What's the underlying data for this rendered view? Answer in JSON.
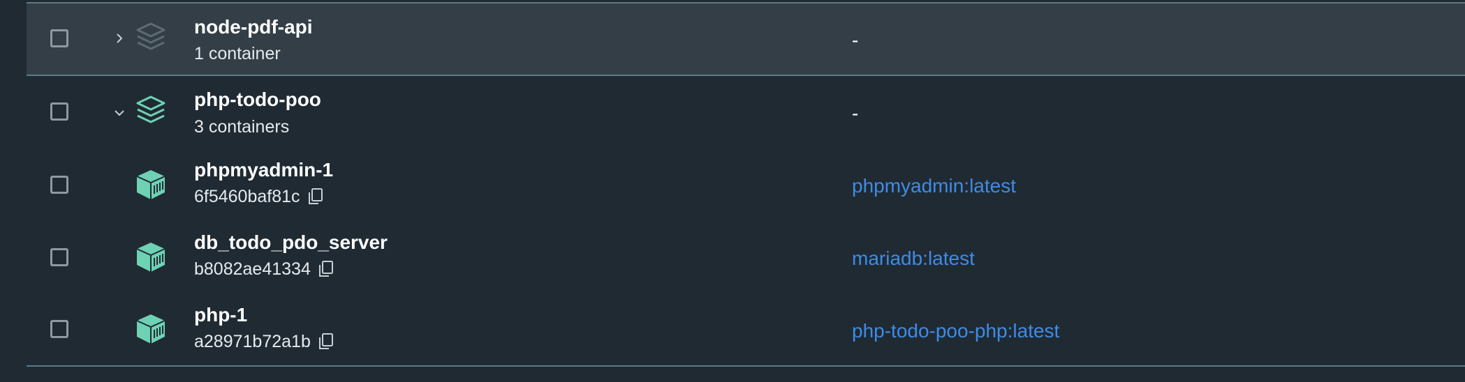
{
  "rows": [
    {
      "name": "node-pdf-api",
      "sub": "1 container",
      "image": "-",
      "kind": "group",
      "expanded": false
    },
    {
      "name": "php-todo-poo",
      "sub": "3 containers",
      "image": "-",
      "kind": "group",
      "expanded": true
    },
    {
      "name": "phpmyadmin-1",
      "sub": "6f5460baf81c",
      "image": "phpmyadmin:latest",
      "kind": "container"
    },
    {
      "name": "db_todo_pdo_server",
      "sub": "b8082ae41334",
      "image": "mariadb:latest",
      "kind": "container"
    },
    {
      "name": "php-1",
      "sub": "a28971b72a1b",
      "image": "php-todo-poo-php:latest",
      "kind": "container"
    }
  ],
  "colors": {
    "background": "#202a33",
    "hover_row": "#333e46",
    "divider": "#5b7a8c",
    "link": "#3d8ce6",
    "container_icon": "#6fd1b4",
    "stack_icon_inactive": "#5d6a72"
  },
  "icons": {
    "stack": "layers-icon",
    "container": "container-icon",
    "copy": "copy-icon",
    "collapsed": "chevron-right-icon",
    "expanded": "chevron-down-icon"
  }
}
